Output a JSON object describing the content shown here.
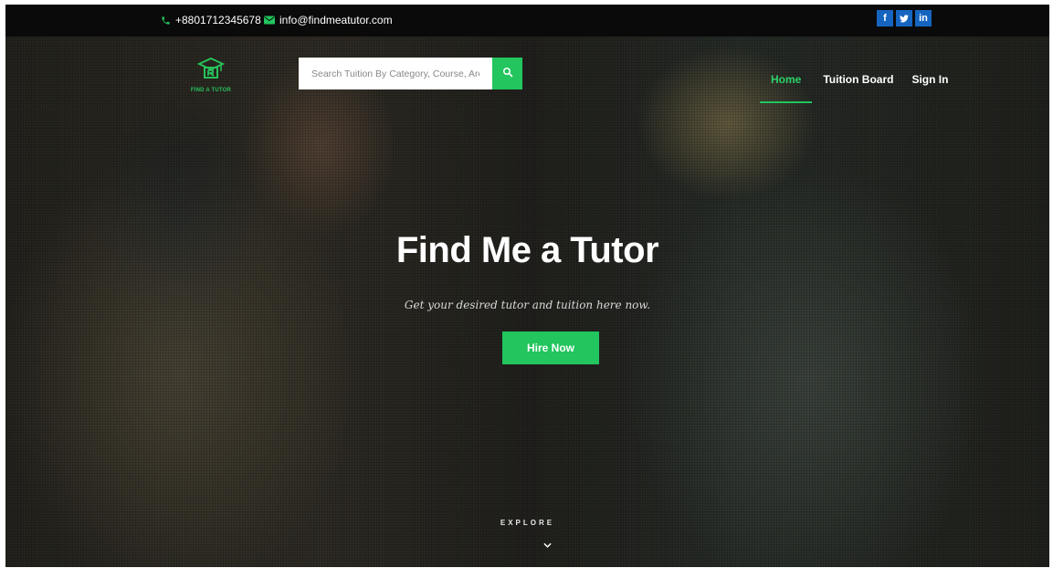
{
  "topbar": {
    "phone": "+8801712345678",
    "email": "info@findmeatutor.com",
    "socials": [
      {
        "label": "f",
        "icon": "facebook-icon",
        "color": "#1565c0"
      },
      {
        "label": "t",
        "icon": "twitter-icon",
        "color": "#1565c0"
      },
      {
        "label": "in",
        "icon": "linkedin-icon",
        "color": "#1565c0"
      }
    ]
  },
  "logo": {
    "text": "FIND A TUTOR",
    "icon": "mortarboard-logo-icon"
  },
  "search": {
    "placeholder": "Search Tuition By Category, Course, Area",
    "button_icon": "search-icon"
  },
  "nav": {
    "items": [
      {
        "label": "Home",
        "active": true
      },
      {
        "label": "Tuition Board",
        "active": false
      },
      {
        "label": "Sign In",
        "active": false
      }
    ]
  },
  "hero": {
    "title": "Find Me a Tutor",
    "subtitle": "Get your desired tutor and tuition here now.",
    "cta_label": "Hire Now",
    "explore_label": "EXPLORE"
  },
  "colors": {
    "accent": "#22c55e",
    "topbar": "#0a0a0a",
    "social": "#1565c0"
  }
}
